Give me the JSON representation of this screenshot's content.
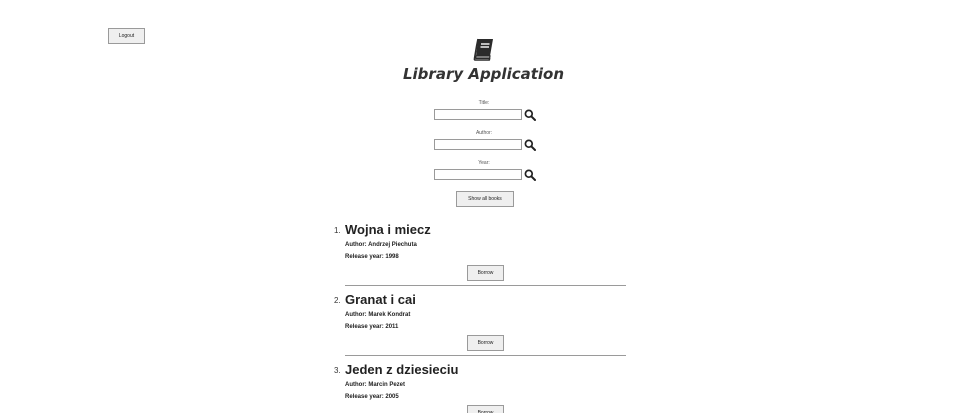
{
  "header": {
    "logout_label": "Logout",
    "title": "Library Application",
    "logo_icon": "book-icon"
  },
  "search": {
    "title_label": "Title:",
    "title_value": "",
    "author_label": "Author:",
    "author_value": "",
    "year_label": "Year:",
    "year_value": "",
    "search_icon": "search-icon",
    "show_all_label": "Show all books"
  },
  "books": [
    {
      "number": "1.",
      "title": "Wojna i miecz",
      "author": "Author: Andrzej Piechuta",
      "year": "Release year: 1998",
      "borrow_label": "Borrow"
    },
    {
      "number": "2.",
      "title": "Granat i cai",
      "author": "Author: Marek Kondrat",
      "year": "Release year: 2011",
      "borrow_label": "Borrow"
    },
    {
      "number": "3.",
      "title": "Jeden z dziesieciu",
      "author": "Author: Marcin Pezet",
      "year": "Release year: 2005",
      "borrow_label": "Borrow"
    }
  ]
}
